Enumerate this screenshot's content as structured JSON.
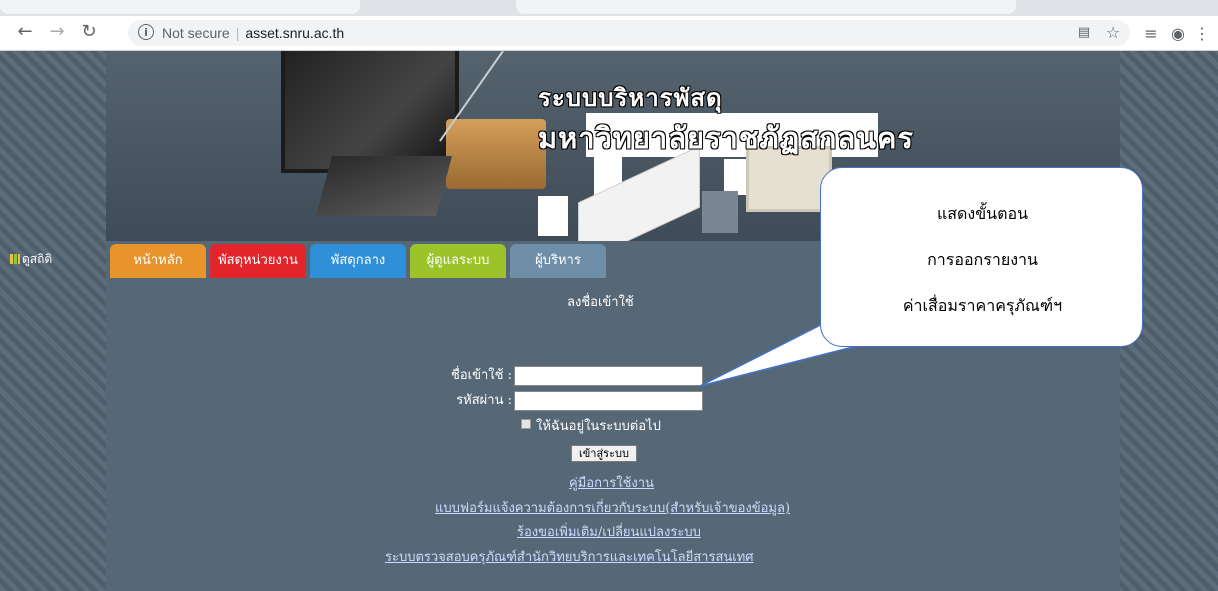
{
  "browser": {
    "security_label": "Not secure",
    "url": "asset.snru.ac.th"
  },
  "banner": {
    "title_line1": "ระบบบริหารพัสดุ",
    "title_line2": "มหาวิทยาลัยราชภัฏสกลนคร"
  },
  "menu": {
    "tabs": [
      {
        "label": "หน้าหลัก",
        "color": "#e8942a"
      },
      {
        "label": "พัสดุหน่วยงาน",
        "color": "#e2242b"
      },
      {
        "label": "พัสดุกลาง",
        "color": "#2f8fd8"
      },
      {
        "label": "ผู้ดูแลระบบ",
        "color": "#9cc42a"
      },
      {
        "label": "ผู้บริหาร",
        "color": "#6f8fa8"
      }
    ]
  },
  "sidebar": {
    "stats_label": "ดูสถิติ"
  },
  "login": {
    "title": "ลงชื่อเข้าใช้",
    "username_label": "ชื่อเข้าใช้ :",
    "username_value": "",
    "password_label": "รหัสผ่าน :",
    "password_value": "",
    "remember_label": "ให้ฉันอยู่ในระบบต่อไป",
    "submit_label": "เข้าสู่ระบบ"
  },
  "links": {
    "manual": "คู่มือการใช้งาน",
    "request_form": "แบบฟอร์มแจ้งความต้องการเกี่ยวกับระบบ(สำหรับเจ้าของข้อมูล)",
    "change_request": "ร้องขอเพิ่มเติม/เปลี่ยนแปลงระบบ",
    "inspection": "ระบบตรวจสอบครุภัณฑ์สำนักวิทยบริการและเทคโนโลยีสารสนเทศ"
  },
  "callout": {
    "line1": "แสดงขั้นตอน",
    "line2": "การออกรายงาน",
    "line3": "ค่าเสื่อมราคาครุภัณฑ์ฯ"
  }
}
